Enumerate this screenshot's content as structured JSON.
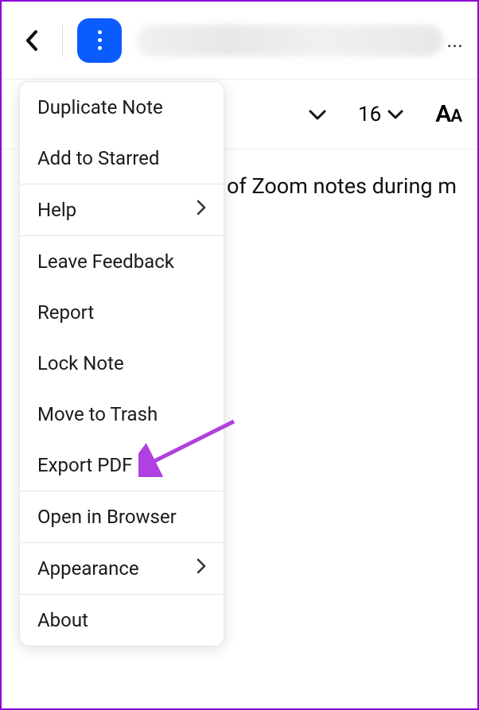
{
  "header": {
    "title_ellipsis": "..."
  },
  "toolbar": {
    "font_size": "16"
  },
  "content": {
    "body_text": "of Zoom notes during m"
  },
  "dropdown": {
    "items": [
      {
        "label": "Duplicate Note",
        "has_submenu": false,
        "section": 0
      },
      {
        "label": "Add to Starred",
        "has_submenu": false,
        "section": 0
      },
      {
        "label": "Help",
        "has_submenu": true,
        "section": 1
      },
      {
        "label": "Leave Feedback",
        "has_submenu": false,
        "section": 2
      },
      {
        "label": "Report",
        "has_submenu": false,
        "section": 2
      },
      {
        "label": "Lock Note",
        "has_submenu": false,
        "section": 2
      },
      {
        "label": "Move to Trash",
        "has_submenu": false,
        "section": 2
      },
      {
        "label": "Export PDF",
        "has_submenu": false,
        "section": 2
      },
      {
        "label": "Open in Browser",
        "has_submenu": false,
        "section": 3
      },
      {
        "label": "Appearance",
        "has_submenu": true,
        "section": 4
      },
      {
        "label": "About",
        "has_submenu": false,
        "section": 5
      }
    ]
  }
}
